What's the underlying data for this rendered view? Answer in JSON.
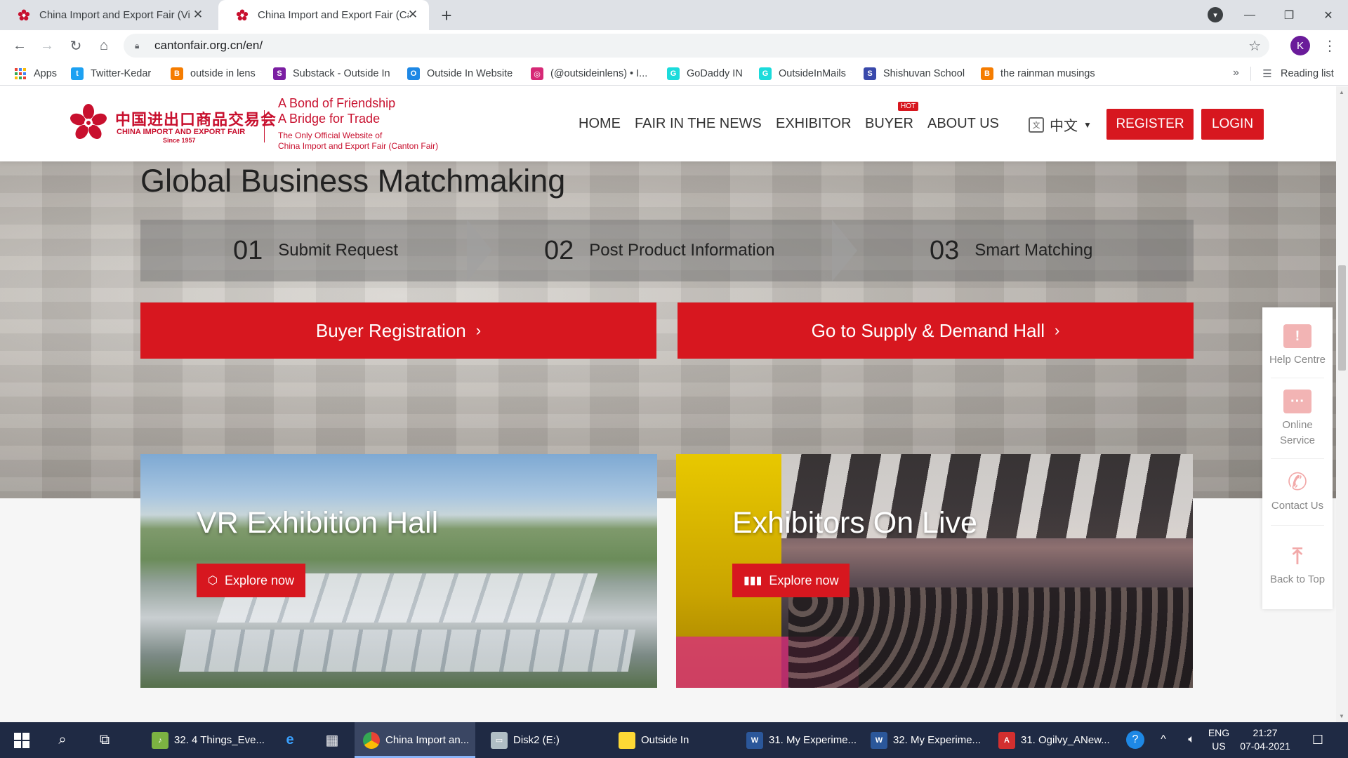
{
  "browser": {
    "tabs": [
      {
        "title": "China Import and Export Fair (Vir",
        "active": false
      },
      {
        "title": "China Import and Export Fair (Ca",
        "active": true
      }
    ],
    "url": "cantonfair.org.cn/en/",
    "profile_initial": "K",
    "bookmarks": [
      {
        "label": "Apps",
        "icon": "apps-grid-icon",
        "color": "#4285f4"
      },
      {
        "label": "Twitter-Kedar",
        "icon": "twitter-icon",
        "color": "#1da1f2"
      },
      {
        "label": "outside in lens",
        "icon": "blogger-icon",
        "color": "#f57c00"
      },
      {
        "label": "Substack - Outside In",
        "icon": "substack-icon",
        "color": "#7b1fa2"
      },
      {
        "label": "Outside In Website",
        "icon": "website-icon",
        "color": "#1e88e5"
      },
      {
        "label": "(@outsideinlens) • I...",
        "icon": "instagram-icon",
        "color": "#d62976"
      },
      {
        "label": "GoDaddy IN",
        "icon": "godaddy-icon",
        "color": "#1bdbdb"
      },
      {
        "label": "OutsideInMails",
        "icon": "godaddy-icon",
        "color": "#1bdbdb"
      },
      {
        "label": "Shishuvan School",
        "icon": "school-icon",
        "color": "#3949ab"
      },
      {
        "label": "the rainman musings",
        "icon": "blogger-icon",
        "color": "#f57c00"
      }
    ],
    "reading_list": "Reading list"
  },
  "site": {
    "logo_cn": "中国进出口商品交易会",
    "logo_en": "CHINA IMPORT AND EXPORT FAIR",
    "logo_since": "Since 1957",
    "slogan_line1": "A Bond of Friendship",
    "slogan_line2": "A Bridge for Trade",
    "slogan_line3": "The Only Official Website of",
    "slogan_line4": "China Import and Export Fair (Canton Fair)",
    "nav": [
      "HOME",
      "FAIR IN THE NEWS",
      "EXHIBITOR",
      "BUYER",
      "ABOUT US"
    ],
    "hot_badge": "HOT",
    "language": "中文",
    "register": "REGISTER",
    "login": "LOGIN"
  },
  "matchmaking": {
    "title": "Global Business Matchmaking",
    "steps": [
      {
        "num": "01",
        "label": "Submit Request"
      },
      {
        "num": "02",
        "label": "Post Product Information"
      },
      {
        "num": "03",
        "label": "Smart Matching"
      }
    ],
    "buyer_registration": "Buyer Registration",
    "supply_demand": "Go to Supply & Demand Hall"
  },
  "cards": [
    {
      "title": "VR Exhibition Hall",
      "button": "Explore now"
    },
    {
      "title": "Exhibitors On Live",
      "button": "Explore now"
    }
  ],
  "side_service": [
    {
      "label": "Help Centre"
    },
    {
      "label": "Online Service"
    },
    {
      "label": "Contact Us"
    },
    {
      "label": "Back to Top"
    }
  ],
  "taskbar": {
    "apps": [
      {
        "label": "32. 4 Things_Eve...",
        "active": false
      },
      {
        "label": "China Import an...",
        "active": true
      },
      {
        "label": "Disk2 (E:)",
        "active": false
      },
      {
        "label": "Outside In",
        "active": false
      },
      {
        "label": "31. My Experime...",
        "active": false
      },
      {
        "label": "32. My Experime...",
        "active": false
      },
      {
        "label": "31. Ogilvy_ANew...",
        "active": false
      }
    ],
    "lang_line1": "ENG",
    "lang_line2": "US",
    "time": "21:27",
    "date": "07-04-2021"
  }
}
